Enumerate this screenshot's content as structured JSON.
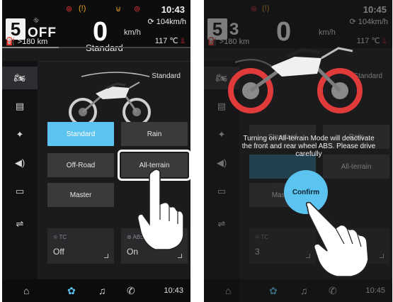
{
  "screen1": {
    "clock": "10:43",
    "gear": "5",
    "gear_state": "OFF",
    "speed": "0",
    "speed_unit": "km/h",
    "speed_limit": "104km/h",
    "range": ">180 km",
    "ride_mode": "Standard",
    "temperature": "117 ℃",
    "mode_label": "Standard",
    "modes": [
      "Standard",
      "Rain",
      "Off-Road",
      "All-terrain",
      "Master"
    ],
    "cards": [
      {
        "label": "TC",
        "value": "Off"
      },
      {
        "label": "ABS",
        "value": "On"
      }
    ],
    "bottom_clock": "10:43"
  },
  "screen2": {
    "clock": "10:45",
    "gear": "5",
    "gear_state": "3",
    "speed": "0",
    "speed_unit": "km/h",
    "speed_limit": "104km/h",
    "range": ">180 km",
    "temperature": "117 ℃",
    "mode_label": "Standard",
    "modes": [
      "Standard",
      "Rain",
      "All-terrain",
      "Master"
    ],
    "alert_text": "Turning on All-terrain Mode will deactivate the front and rear wheel ABS. Please drive carefully",
    "confirm_label": "Confirm",
    "cards": [
      {
        "label": "TC",
        "value": "3"
      },
      {
        "label": "",
        "value": "On"
      }
    ],
    "bottom_clock": "10:45"
  },
  "colors": {
    "accent": "#5bc3f0",
    "warning_red": "#e03030",
    "warning_amber": "#e8a020",
    "tire_highlight": "#e03a3a"
  },
  "icons": [
    "motorcycle-icon",
    "dashboard-icon",
    "satellite-icon",
    "speaker-icon",
    "display-icon",
    "sliders-icon",
    "home-icon",
    "settings-icon",
    "music-icon",
    "phone-icon"
  ]
}
